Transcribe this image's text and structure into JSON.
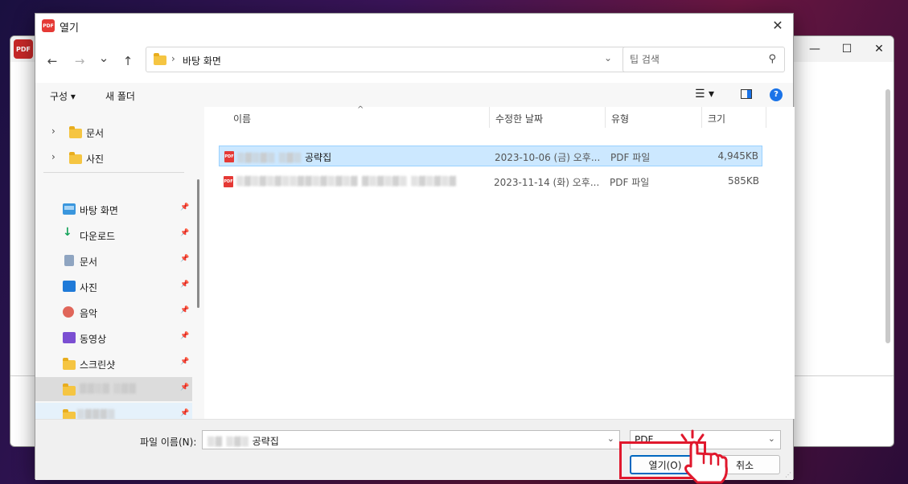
{
  "background_window": {
    "icon_label": "PDF",
    "controls": {
      "minimize": "—",
      "maximize": "☐",
      "close": "✕"
    }
  },
  "dialog": {
    "logo_text": "PDF",
    "title": "열기",
    "close_glyph": "✕"
  },
  "nav": {
    "back_glyph": "←",
    "forward_glyph": "→",
    "recent_glyph": "⌄",
    "up_glyph": "↑",
    "address_sep": "›",
    "address_text": "바탕 화면",
    "address_chevron": "⌄",
    "refresh_glyph": "↻",
    "search_placeholder": "팁 검색",
    "search_glyph": "⚲"
  },
  "toolbar": {
    "organize_label": "구성 ▾",
    "new_folder_label": "새 폴더",
    "view_glyph": "☰ ▾",
    "help_glyph": "?"
  },
  "sidebar": {
    "tree_items": [
      {
        "chevron": "›",
        "label": "문서"
      },
      {
        "chevron": "›",
        "label": "사진"
      }
    ],
    "quick_items": [
      {
        "label": "바탕 화면",
        "icon": "desktop-icon"
      },
      {
        "label": "다운로드",
        "icon": "download-icon",
        "glyph": "↓"
      },
      {
        "label": "문서",
        "icon": "document-icon"
      },
      {
        "label": "사진",
        "icon": "pictures-icon"
      },
      {
        "label": "음악",
        "icon": "music-icon"
      },
      {
        "label": "동영상",
        "icon": "video-icon"
      },
      {
        "label": "스크린샷",
        "icon": "folder-icon"
      }
    ],
    "pin_glyph": "📌"
  },
  "columns": {
    "name": "이름",
    "date": "수정한 날짜",
    "type": "유형",
    "size": "크기",
    "sort_caret": "^"
  },
  "files": [
    {
      "name_suffix": "공략집",
      "date": "2023-10-06 (금) 오후...",
      "type": "PDF 파일",
      "size": "4,945KB",
      "icon_text": "PDF"
    },
    {
      "date": "2023-11-14 (화) 오후...",
      "type": "PDF 파일",
      "size": "585KB",
      "icon_text": "PDF"
    }
  ],
  "footer": {
    "filename_label": "파일 이름(N):",
    "filename_suffix": "공략집",
    "filename_chevron": "⌄",
    "type_value": "PDF",
    "type_chevron": "⌄",
    "open_button": "열기(O)",
    "cancel_button": "취소",
    "grip": "⋰"
  },
  "colors": {
    "selection": "#cce8ff",
    "accent": "#0067c0",
    "highlight_red": "#e0182d"
  }
}
